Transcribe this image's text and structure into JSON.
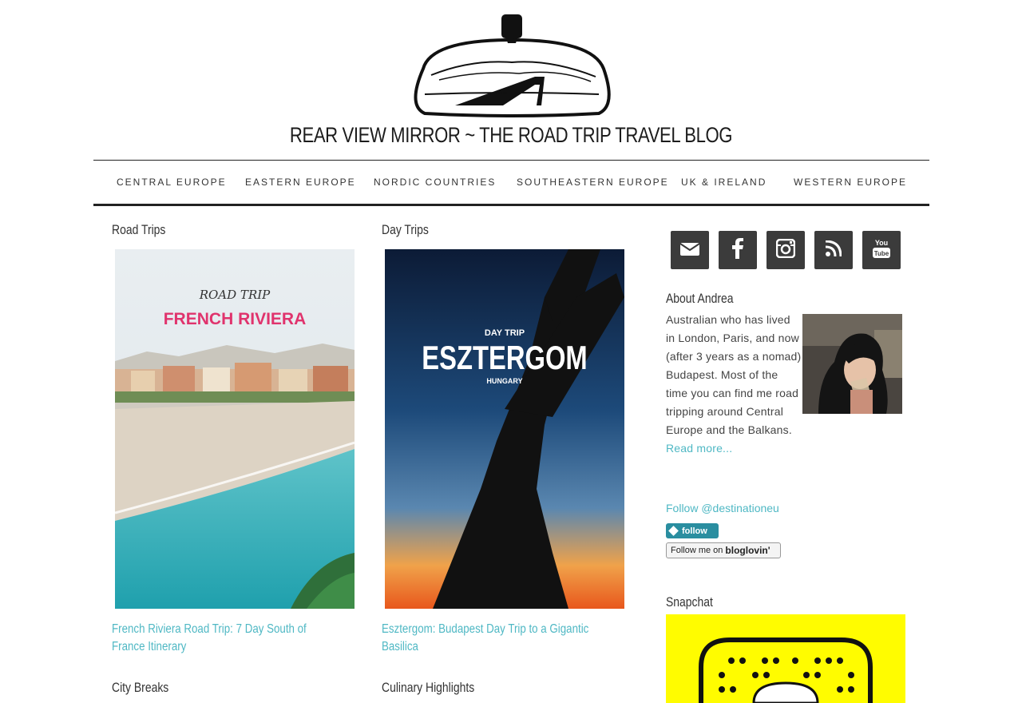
{
  "header": {
    "site_title": "REAR VIEW MIRROR ~ THE ROAD TRIP TRAVEL BLOG"
  },
  "nav": {
    "items": [
      {
        "label": "CENTRAL EUROPE"
      },
      {
        "label": "EASTERN EUROPE"
      },
      {
        "label": "NORDIC COUNTRIES"
      },
      {
        "label": "SOUTHEASTERN EUROPE"
      },
      {
        "label": "UK & IRELAND"
      },
      {
        "label": "WESTERN EUROPE"
      }
    ]
  },
  "sections": {
    "road_trips": {
      "title": "Road Trips",
      "poster_kicker": "ROAD TRIP",
      "poster_title": "FRENCH RIVIERA",
      "post_title": "French Riviera Road Trip: 7 Day South of France Itinerary"
    },
    "day_trips": {
      "title": "Day Trips",
      "poster_kicker": "DAY TRIP",
      "poster_title": "ESZTERGOM",
      "poster_subtitle": "HUNGARY",
      "post_title": "Esztergom: Budapest Day Trip to a Gigantic Basilica"
    },
    "city_breaks": {
      "title": "City Breaks"
    },
    "culinary": {
      "title": "Culinary Highlights"
    }
  },
  "sidebar": {
    "social_icons": [
      "email-icon",
      "facebook-icon",
      "instagram-icon",
      "rss-icon",
      "youtube-icon"
    ],
    "about": {
      "title": "About Andrea",
      "text": "Australian who has lived in London, Paris, and now (after 3 years as a nomad) Budapest. Most of the time you can find me road tripping around Central Europe and the Balkans.",
      "read_more": "Read more..."
    },
    "twitter_follow": "Follow @destinationeu",
    "follow_button": "follow",
    "bloglovin_prefix": "Follow me on",
    "bloglovin_brand": "bloglovin'",
    "snapchat_title": "Snapchat"
  },
  "colors": {
    "accent": "#4fb8c4",
    "social_bg": "#3b3b3b",
    "snapchat_yellow": "#fffc00",
    "nav_border": "#222222"
  }
}
